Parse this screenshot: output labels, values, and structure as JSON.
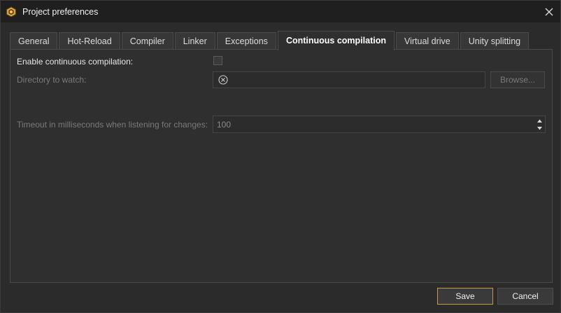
{
  "window": {
    "title": "Project preferences",
    "app_icon": "live-plus-plus-logo-icon",
    "close_icon": "close-icon"
  },
  "tabs": [
    {
      "label": "General",
      "active": false
    },
    {
      "label": "Hot-Reload",
      "active": false
    },
    {
      "label": "Compiler",
      "active": false
    },
    {
      "label": "Linker",
      "active": false
    },
    {
      "label": "Exceptions",
      "active": false
    },
    {
      "label": "Continuous compilation",
      "active": true
    },
    {
      "label": "Virtual drive",
      "active": false
    },
    {
      "label": "Unity splitting",
      "active": false
    }
  ],
  "settings": {
    "enable_label": "Enable continuous compilation:",
    "enable_checked": false,
    "directory_label": "Directory to watch:",
    "directory_value": "",
    "browse_label": "Browse...",
    "timeout_label": "Timeout in milliseconds when listening for changes:",
    "timeout_value": "100"
  },
  "footer": {
    "save_label": "Save",
    "cancel_label": "Cancel"
  },
  "colors": {
    "accent": "#c89a45",
    "background": "#2b2b2b",
    "titlebar": "#1f1f1f"
  }
}
